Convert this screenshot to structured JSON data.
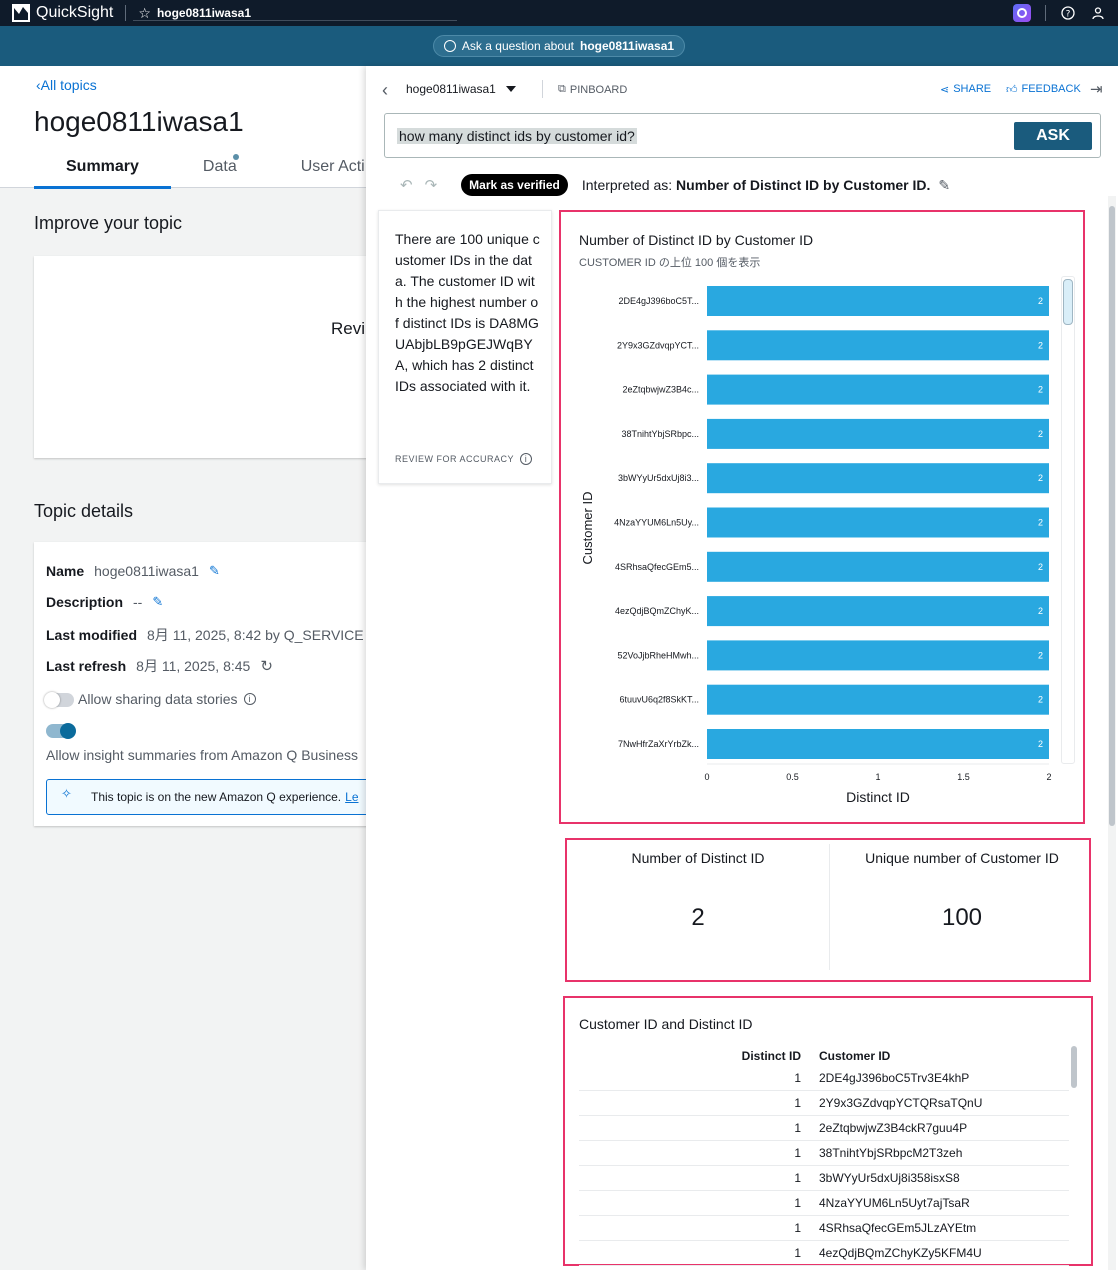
{
  "app": {
    "name": "QuickSight",
    "topic_title": "hoge0811iwasa1"
  },
  "askbar": {
    "prefix": "Ask a question about",
    "topic": "hoge0811iwasa1"
  },
  "left": {
    "back_link": "All topics",
    "title": "hoge0811iwasa1",
    "tabs": [
      {
        "label": "Summary"
      },
      {
        "label": "Data"
      },
      {
        "label": "User Acti"
      }
    ],
    "improve_heading": "Improve your topic",
    "improve_card_text": "Revi",
    "details_heading": "Topic details",
    "details": {
      "name_label": "Name",
      "name_value": "hoge0811iwasa1",
      "desc_label": "Description",
      "desc_value": "--",
      "modified_label": "Last modified",
      "modified_value": "8月 11, 2025, 8:42 by Q_SERVICE",
      "refresh_label": "Last refresh",
      "refresh_value": "8月 11, 2025, 8:45",
      "sharing_label": "Allow sharing data stories",
      "insight_label": "Allow insight summaries from Amazon Q Business",
      "notice_text": "This topic is on the new Amazon Q experience.",
      "notice_link": "Le"
    }
  },
  "panel": {
    "topic_select": "hoge0811iwasa1",
    "pinboard": "PINBOARD",
    "share": "SHARE",
    "feedback": "FEEDBACK",
    "question": "how many distinct ids by customer id?",
    "ask_button": "ASK",
    "verify_button": "Mark as verified",
    "interpreted_prefix": "Interpreted as:",
    "interpreted_value": "Number of Distinct ID by Customer ID.",
    "summary_text": "There are 100 unique customer IDs in the data. The customer ID with the highest number of distinct IDs is DA8MGUAbjbLB9pGEJWqBYA, which has 2 distinct IDs associated with it.",
    "review_label": "REVIEW FOR ACCURACY"
  },
  "chart_data": {
    "type": "bar",
    "orientation": "horizontal",
    "title": "Number of Distinct ID by Customer ID",
    "subtitle": "CUSTOMER ID の上位 100 個を表示",
    "xlabel": "Distinct ID",
    "ylabel": "Customer ID",
    "categories": [
      "2DE4gJ396boC5T...",
      "2Y9x3GZdvqpYCT...",
      "2eZtqbwjwZ3B4c...",
      "38TnihtYbjSRbpc...",
      "3bWYyUr5dxUj8i3...",
      "4NzaYYUM6Ln5Uy...",
      "4SRhsaQfecGEm5...",
      "4ezQdjBQmZChyK...",
      "52VoJjbRheHMwh...",
      "6tuuvU6q2f8SkKT...",
      "7NwHfrZaXrYrbZk..."
    ],
    "values": [
      2,
      2,
      2,
      2,
      2,
      2,
      2,
      2,
      2,
      2,
      2
    ],
    "xlim": [
      0,
      2
    ],
    "xticks": [
      "0",
      "0.5",
      "1",
      "1.5",
      "2"
    ],
    "bar_color": "#29a8e0"
  },
  "kpis": [
    {
      "label": "Number of Distinct ID",
      "value": "2"
    },
    {
      "label": "Unique number of Customer ID",
      "value": "100"
    }
  ],
  "table": {
    "title": "Customer ID and Distinct ID",
    "columns": [
      "Distinct ID",
      "Customer ID"
    ],
    "rows": [
      [
        "1",
        "2DE4gJ396boC5Trv3E4khP"
      ],
      [
        "1",
        "2Y9x3GZdvqpYCTQRsaTQnU"
      ],
      [
        "1",
        "2eZtqbwjwZ3B4ckR7guu4P"
      ],
      [
        "1",
        "38TnihtYbjSRbpcM2T3zeh"
      ],
      [
        "1",
        "3bWYyUr5dxUj8i358isxS8"
      ],
      [
        "1",
        "4NzaYYUM6Ln5Uyt7ajTsaR"
      ],
      [
        "1",
        "4SRhsaQfecGEm5JLzAYEtm"
      ],
      [
        "1",
        "4ezQdjBQmZChyKZy5KFM4U"
      ]
    ]
  }
}
